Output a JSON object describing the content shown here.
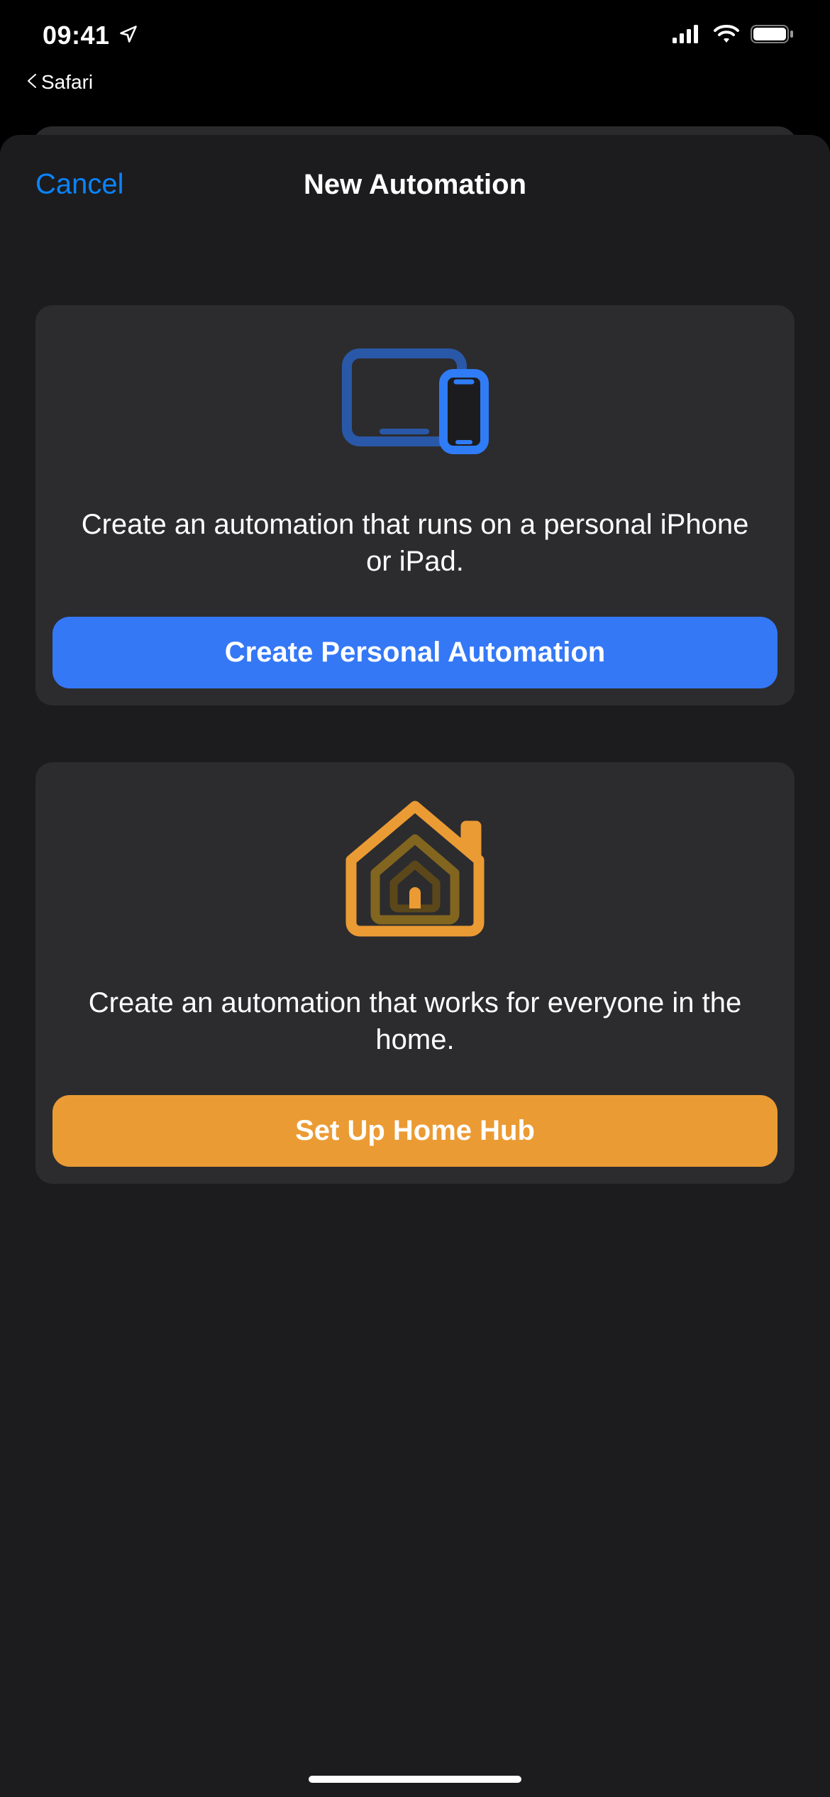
{
  "statusBar": {
    "time": "09:41",
    "back_app_label": "Safari"
  },
  "nav": {
    "cancel_label": "Cancel",
    "title": "New Automation"
  },
  "cards": {
    "personal": {
      "description": "Create an automation that runs on a personal iPhone or iPad.",
      "button_label": "Create Personal Automation"
    },
    "home": {
      "description": "Create an automation that works for everyone in the home.",
      "button_label": "Set Up Home Hub"
    }
  },
  "colors": {
    "accent_blue": "#0a84ff",
    "button_blue": "#3478f6",
    "button_orange": "#eb9b34",
    "card_bg": "#2c2c2e",
    "sheet_bg": "#1c1c1e"
  }
}
